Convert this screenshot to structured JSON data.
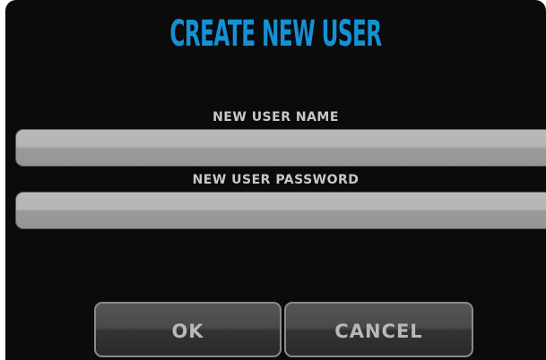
{
  "dialog": {
    "title": "CREATE NEW USER",
    "username": {
      "label": "NEW USER NAME",
      "value": "",
      "placeholder": ""
    },
    "password": {
      "label": "NEW USER PASSWORD",
      "value": "",
      "placeholder": ""
    },
    "buttons": {
      "ok_label": "OK",
      "cancel_label": "CANCEL"
    }
  },
  "colors": {
    "title": "#1591d6",
    "background": "#0b0b0b",
    "label": "#c8c8c8",
    "field": "#aaaaaa",
    "button": "#404040"
  }
}
